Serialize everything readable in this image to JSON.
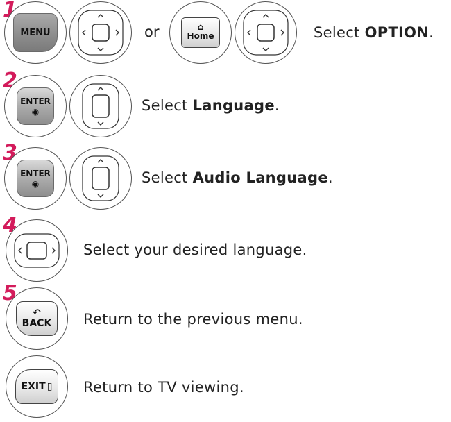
{
  "steps": [
    {
      "number": "1",
      "keys": [
        "MENU",
        "Home"
      ],
      "connector": "or",
      "prefix": "Select ",
      "bold": "OPTION",
      "suffix": "."
    },
    {
      "number": "2",
      "key": "ENTER",
      "prefix": "Select ",
      "bold": "Language",
      "suffix": "."
    },
    {
      "number": "3",
      "key": "ENTER",
      "prefix": "Select ",
      "bold": "Audio Language",
      "suffix": "."
    },
    {
      "number": "4",
      "text": "Select your desired language."
    },
    {
      "number": "5",
      "key": "BACK",
      "text": "Return to the previous menu."
    },
    {
      "key": "EXIT",
      "text": "Return to TV viewing."
    }
  ],
  "colors": {
    "step_number": "#d31b5b",
    "key_gray": "#a9a9a9"
  },
  "icons": {
    "enter_dot": "◉",
    "back_arrow": "↶",
    "home_roof": "⌂",
    "exit_bracket": "▯"
  }
}
